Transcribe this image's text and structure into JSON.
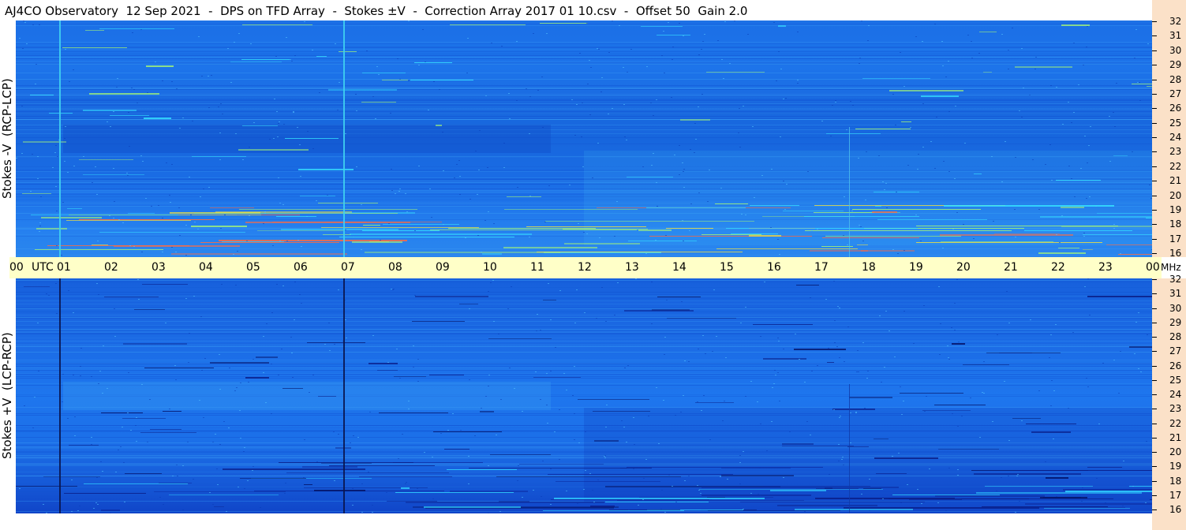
{
  "title": "AJ4CO Observatory  12 Sep 2021  -  DPS on TFD Array  -  Stokes ±V  -  Correction Array 2017 01 10.csv  -  Offset 50  Gain 2.0",
  "panels": [
    {
      "id": "top",
      "ylabel": "Stokes -V  (RCP-LCP)"
    },
    {
      "id": "bottom",
      "ylabel": "Stokes +V  (LCP-RCP)"
    }
  ],
  "time_axis": {
    "labels": [
      "00",
      "01",
      "02",
      "03",
      "04",
      "05",
      "06",
      "07",
      "08",
      "09",
      "10",
      "11",
      "12",
      "13",
      "14",
      "15",
      "16",
      "17",
      "18",
      "19",
      "20",
      "21",
      "22",
      "23",
      "00"
    ],
    "unit_left": "UTC",
    "unit_right": "MHz"
  },
  "freq_axis": {
    "labels": [
      "32",
      "31",
      "30",
      "29",
      "28",
      "27",
      "26",
      "25",
      "24",
      "23",
      "22",
      "21",
      "20",
      "19",
      "18",
      "17",
      "16"
    ]
  },
  "colors": {
    "background_low": "#0d3fc4",
    "background_mid": "#1e74ea",
    "background_high": "#2a90f0",
    "time_axis_bg": "#ffffc8",
    "freq_axis_bg": "#fbe1c8"
  },
  "chart_data": [
    {
      "type": "heatmap",
      "title": "AJ4CO Observatory  12 Sep 2021  -  DPS on TFD Array  -  Stokes ±V  -  Correction Array 2017 01 10.csv  -  Offset 50  Gain 2.0",
      "ylabel": "Stokes -V  (RCP-LCP)",
      "xlabel": "UTC",
      "x_ticks": [
        "00",
        "01",
        "02",
        "03",
        "04",
        "05",
        "06",
        "07",
        "08",
        "09",
        "10",
        "11",
        "12",
        "13",
        "14",
        "15",
        "16",
        "17",
        "18",
        "19",
        "20",
        "21",
        "22",
        "23",
        "00"
      ],
      "xlim": [
        0,
        24
      ],
      "y_ticks": [
        32,
        31,
        30,
        29,
        28,
        27,
        26,
        25,
        24,
        23,
        22,
        21,
        20,
        19,
        18,
        17,
        16
      ],
      "ylim": [
        16,
        32
      ],
      "y_unit": "MHz"
    },
    {
      "type": "heatmap",
      "ylabel": "Stokes +V  (LCP-RCP)",
      "xlabel": "UTC",
      "x_ticks": [
        "00",
        "01",
        "02",
        "03",
        "04",
        "05",
        "06",
        "07",
        "08",
        "09",
        "10",
        "11",
        "12",
        "13",
        "14",
        "15",
        "16",
        "17",
        "18",
        "19",
        "20",
        "21",
        "22",
        "23",
        "00"
      ],
      "xlim": [
        0,
        24
      ],
      "y_ticks": [
        32,
        31,
        30,
        29,
        28,
        27,
        26,
        25,
        24,
        23,
        22,
        21,
        20,
        19,
        18,
        17,
        16
      ],
      "ylim": [
        16,
        32
      ],
      "y_unit": "MHz"
    }
  ]
}
